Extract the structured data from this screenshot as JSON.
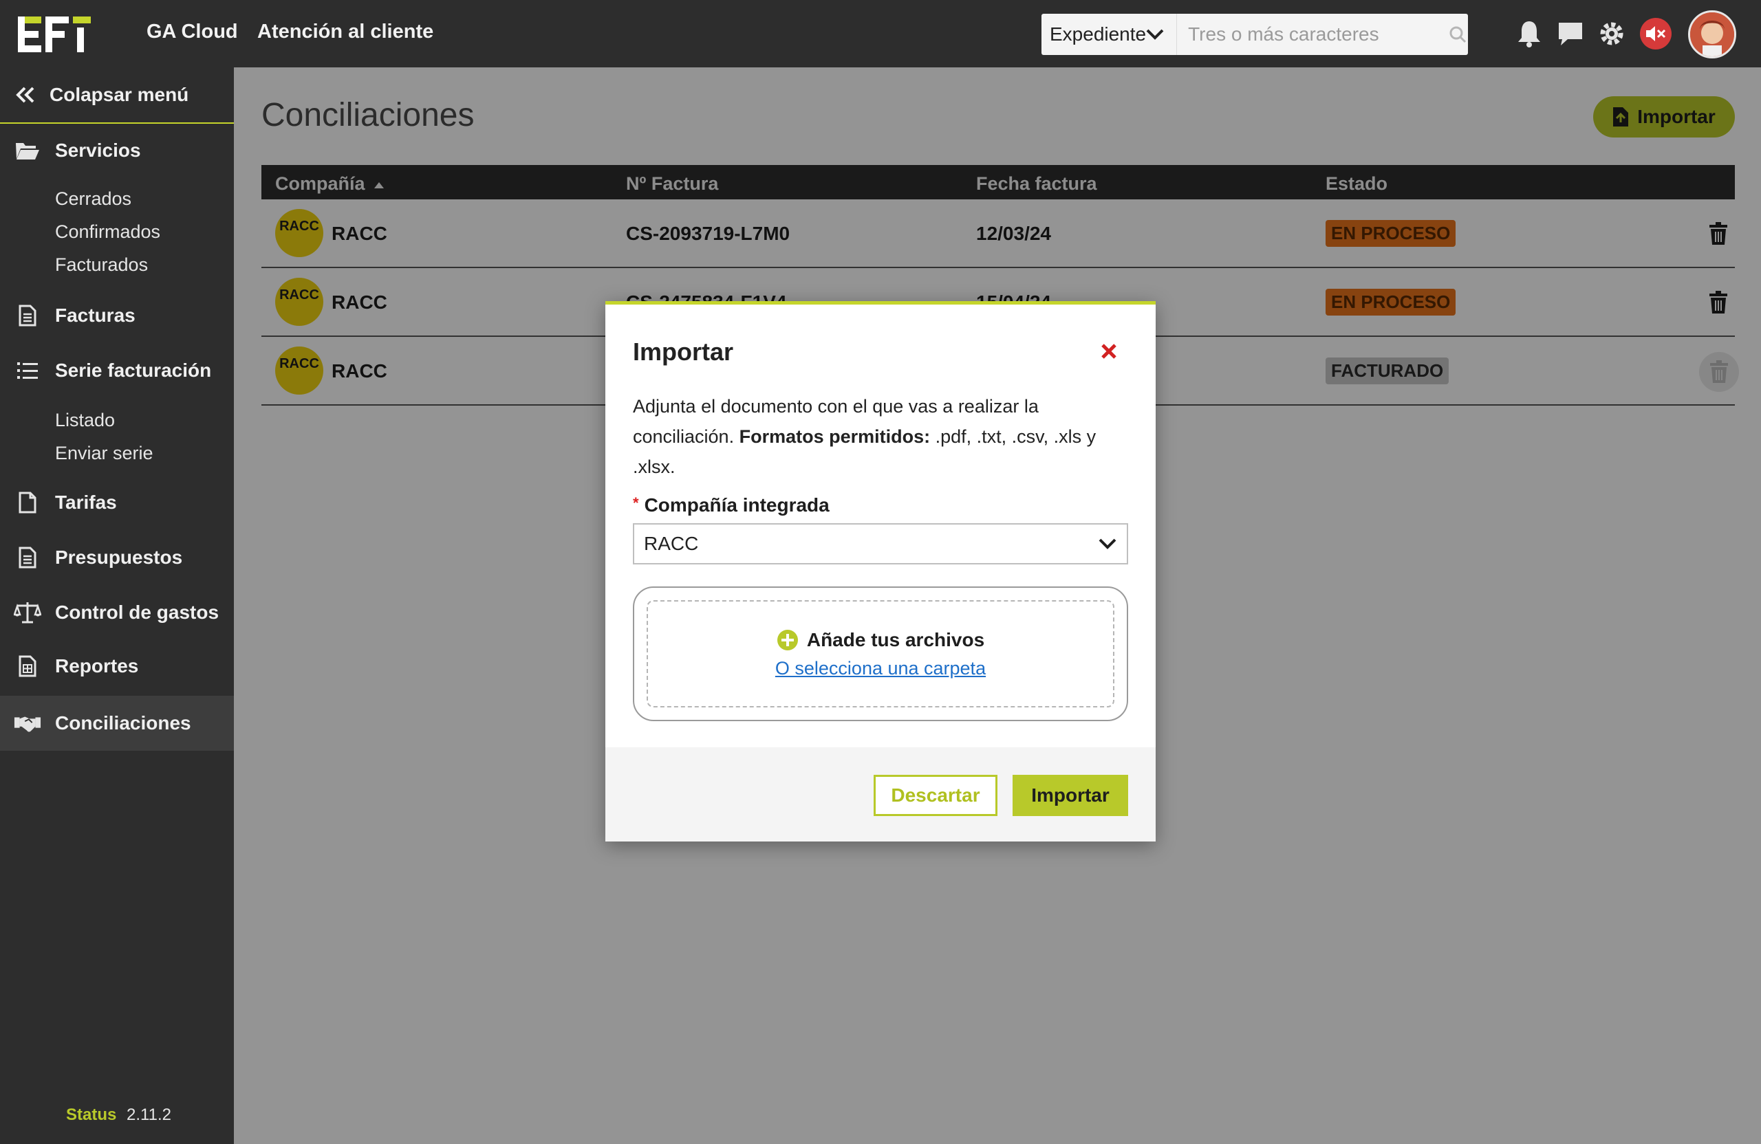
{
  "header": {
    "links": [
      "GA Cloud",
      "Atención al cliente"
    ],
    "search": {
      "selected": "Expediente",
      "placeholder": "Tres o más caracteres"
    },
    "icons": [
      "bell-icon",
      "chat-icon",
      "gear-icon",
      "muted-speaker-icon"
    ]
  },
  "sidebar": {
    "collapse_label": "Colapsar menú",
    "items": [
      {
        "label": "Servicios",
        "icon": "folder-open-icon"
      },
      {
        "label": "Facturas",
        "icon": "document-icon"
      },
      {
        "label": "Serie facturación",
        "icon": "list-icon"
      },
      {
        "label": "Tarifas",
        "icon": "file-icon"
      },
      {
        "label": "Presupuestos",
        "icon": "document-icon"
      },
      {
        "label": "Control de gastos",
        "icon": "balance-scale-icon"
      },
      {
        "label": "Reportes",
        "icon": "report-icon"
      },
      {
        "label": "Conciliaciones",
        "icon": "handshake-icon"
      }
    ],
    "servicios_sub": [
      "Cerrados",
      "Confirmados",
      "Facturados"
    ],
    "serie_sub": [
      "Listado",
      "Enviar serie"
    ],
    "status_label": "Status",
    "version": "2.11.2"
  },
  "main": {
    "title": "Conciliaciones",
    "import_button": "Importar",
    "columns": [
      "Compañía",
      "Nº Factura",
      "Fecha factura",
      "Estado"
    ],
    "rows": [
      {
        "logo": "RACC",
        "company": "RACC",
        "invoice": "CS-2093719-L7M0",
        "date": "12/03/24",
        "status": "EN PROCESO"
      },
      {
        "logo": "RACC",
        "company": "RACC",
        "invoice": "CS-2475834-F1V4",
        "date": "15/04/24",
        "status": "EN PROCESO"
      },
      {
        "logo": "RACC",
        "company": "RACC",
        "invoice": "",
        "date": "",
        "status": "FACTURADO"
      }
    ]
  },
  "modal": {
    "title": "Importar",
    "desc_plain": "Adjunta el documento con el que vas a realizar la conciliación. ",
    "desc_bold": "Formatos permitidos:",
    "desc_formats": " .pdf, .txt, .csv, .xls y .xlsx.",
    "field_required_mark": "*",
    "field_label": "Compañía integrada",
    "field_value": "RACC",
    "drop_title": "Añade tus archivos",
    "drop_link": "O selecciona una carpeta",
    "discard_button": "Descartar",
    "import_button": "Importar"
  },
  "colors": {
    "accent": "#b8c92a",
    "dark": "#2d2d2d",
    "in_process": "#e8741d",
    "invoiced": "#c8c8c8",
    "close": "#d22222",
    "link": "#1e6fc9"
  }
}
